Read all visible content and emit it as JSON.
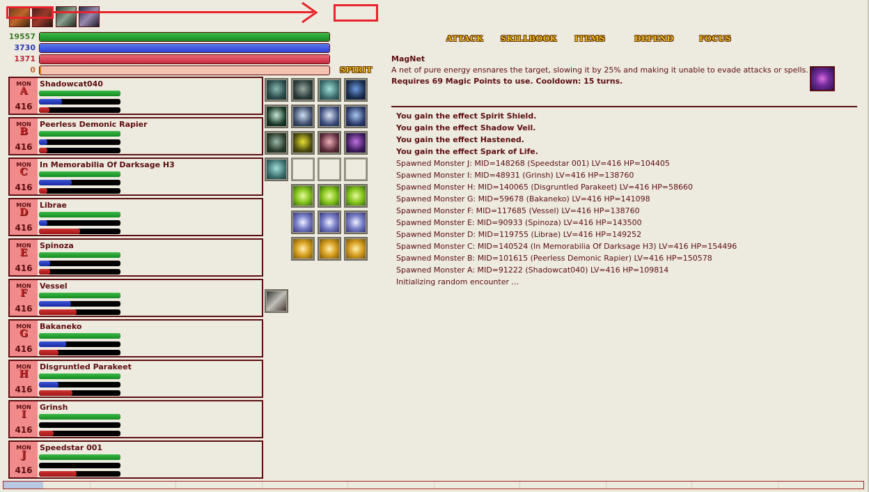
{
  "player": {
    "hp_value": "19557",
    "mp_value": "3730",
    "sp_value": "1371",
    "oc_value": "0",
    "hp_fill": 1.0,
    "mp_fill": 1.0,
    "sp_fill": 1.0,
    "oc_fill": 0.005,
    "spirit_label": "SPIRIT"
  },
  "menu": {
    "attack": "ATTACK",
    "skillbook": "SKILLBOOK",
    "items": "ITEMS",
    "defend": "DEFEND",
    "focus": "FOCUS"
  },
  "skill": {
    "name": "MagNet",
    "description": "A net of pure energy ensnares the target, slowing it by 25% and making it unable to evade attacks or spells.",
    "requirement": "Requires 69 Magic Points to use. Cooldown: 15 turns."
  },
  "monsters": [
    {
      "tag": "MON",
      "letter": "A",
      "level": "416",
      "name": "Shadowcat040",
      "hp": 1.0,
      "mp": 0.28,
      "sp": 0.13
    },
    {
      "tag": "MON",
      "letter": "B",
      "level": "416",
      "name": "Peerless Demonic Rapier",
      "hp": 1.0,
      "mp": 0.1,
      "sp": 0.1
    },
    {
      "tag": "MON",
      "letter": "C",
      "level": "416",
      "name": "In Memorabilia Of Darksage H3",
      "hp": 1.0,
      "mp": 0.4,
      "sp": 0.1
    },
    {
      "tag": "MON",
      "letter": "D",
      "level": "416",
      "name": "Librae",
      "hp": 1.0,
      "mp": 0.1,
      "sp": 0.5
    },
    {
      "tag": "MON",
      "letter": "E",
      "level": "416",
      "name": "Spinoza",
      "hp": 1.0,
      "mp": 0.14,
      "sp": 0.14
    },
    {
      "tag": "MON",
      "letter": "F",
      "level": "416",
      "name": "Vessel",
      "hp": 1.0,
      "mp": 0.39,
      "sp": 0.46
    },
    {
      "tag": "MON",
      "letter": "G",
      "level": "416",
      "name": "Bakaneko",
      "hp": 1.0,
      "mp": 0.33,
      "sp": 0.24
    },
    {
      "tag": "MON",
      "letter": "H",
      "level": "416",
      "name": "Disgruntled Parakeet",
      "hp": 1.0,
      "mp": 0.24,
      "sp": 0.41
    },
    {
      "tag": "MON",
      "letter": "I",
      "level": "416",
      "name": "Grinsh",
      "hp": 1.0,
      "mp": 0.0,
      "sp": 0.18
    },
    {
      "tag": "MON",
      "letter": "J",
      "level": "416",
      "name": "Speedstar 001",
      "hp": 1.0,
      "mp": 0.0,
      "sp": 0.46
    }
  ],
  "log": [
    {
      "text": "You gain the effect Spirit Shield.",
      "bold": true
    },
    {
      "text": "You gain the effect Shadow Veil.",
      "bold": true
    },
    {
      "text": "You gain the effect Hastened.",
      "bold": true
    },
    {
      "text": "You gain the effect Spark of Life.",
      "bold": true
    },
    {
      "text": "Spawned Monster J: MID=148268 (Speedstar 001) LV=416 HP=104405",
      "bold": false
    },
    {
      "text": "Spawned Monster I: MID=48931 (Grinsh) LV=416 HP=138760",
      "bold": false
    },
    {
      "text": "Spawned Monster H: MID=140065 (Disgruntled Parakeet) LV=416 HP=58660",
      "bold": false
    },
    {
      "text": "Spawned Monster G: MID=59678 (Bakaneko) LV=416 HP=141098",
      "bold": false
    },
    {
      "text": "Spawned Monster F: MID=117685 (Vessel) LV=416 HP=138760",
      "bold": false
    },
    {
      "text": "Spawned Monster E: MID=90933 (Spinoza) LV=416 HP=143500",
      "bold": false
    },
    {
      "text": "Spawned Monster D: MID=119755 (Librae) LV=416 HP=149252",
      "bold": false
    },
    {
      "text": "Spawned Monster C: MID=140524 (In Memorabilia Of Darksage H3) LV=416 HP=154496",
      "bold": false
    },
    {
      "text": "Spawned Monster B: MID=101615 (Peerless Demonic Rapier) LV=416 HP=150578",
      "bold": false
    },
    {
      "text": "Spawned Monster A: MID=91222 (Shadowcat040) LV=416 HP=109814",
      "bold": false
    },
    {
      "text": "Initializing random encounter ...",
      "bold": false
    }
  ],
  "colors": {
    "hp": "#1E9A2E",
    "mp": "#2E44C8",
    "sp": "#C8243A",
    "text": "#5C0D11",
    "annotation": "#E8232B"
  }
}
